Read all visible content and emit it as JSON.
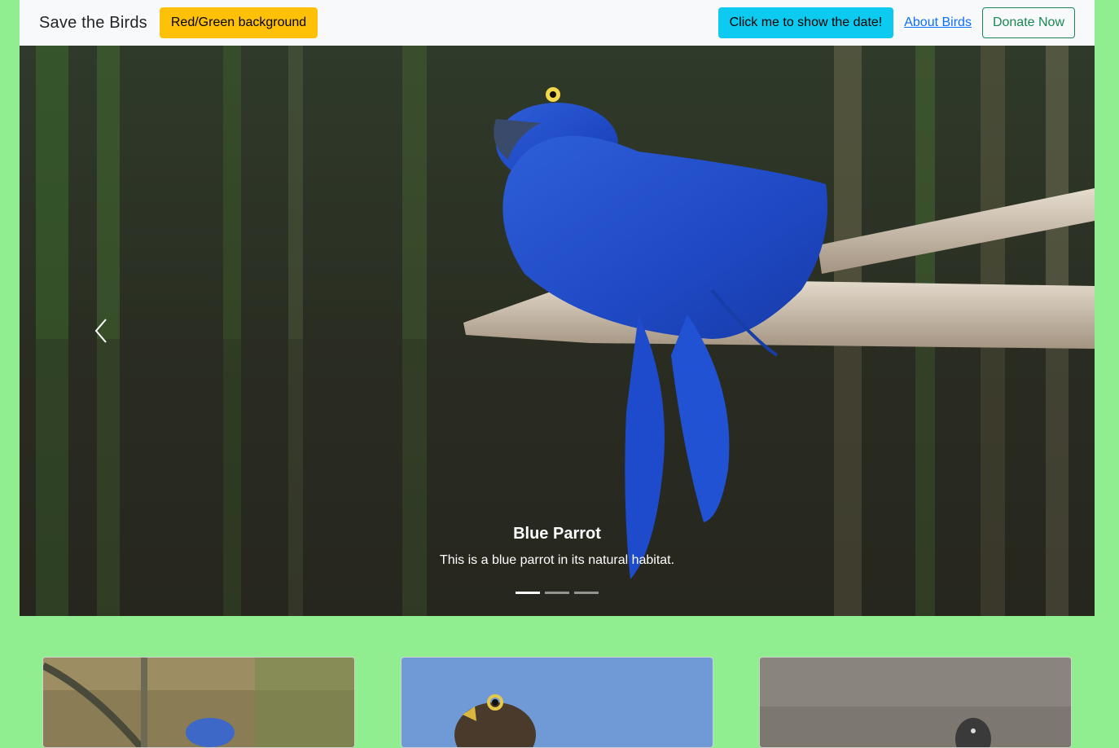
{
  "navbar": {
    "brand": "Save the Birds",
    "bg_toggle_label": "Red/Green background",
    "date_button_label": "Click me to show the date!",
    "about_link_label": "About Birds",
    "donate_label": "Donate Now"
  },
  "carousel": {
    "active_index": 0,
    "slide_count": 3,
    "caption_title": "Blue Parrot",
    "caption_text": "This is a blue parrot in its natural habitat."
  },
  "cards": [
    {
      "image": "blue-jay-photo"
    },
    {
      "image": "falcon-photo"
    },
    {
      "image": "gray-bird-photo"
    }
  ],
  "colors": {
    "page_bg": "#90ee90",
    "navbar_bg": "#f8f9fa",
    "warning": "#ffc107",
    "info": "#0dcaf0",
    "link": "#0d6efd",
    "success": "#198754"
  }
}
